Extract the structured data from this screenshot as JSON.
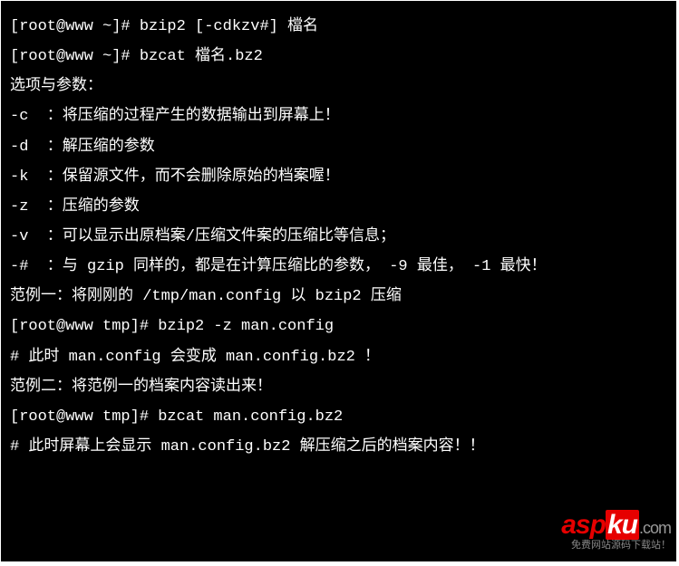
{
  "lines": {
    "l1": "[root@www ~]# bzip2 [-cdkzv#] 檔名",
    "l2": "[root@www ~]# bzcat 檔名.bz2",
    "l3": "选项与参数：",
    "l4": "-c  ：将压缩的过程产生的数据输出到屏幕上！",
    "l5": "-d  ：解压缩的参数",
    "l6": "-k  ：保留源文件，而不会删除原始的档案喔！",
    "l7": "-z  ：压缩的参数",
    "l8": "-v  ：可以显示出原档案/压缩文件案的压缩比等信息；",
    "l9": "-#  ：与 gzip 同样的，都是在计算压缩比的参数， -9 最佳， -1 最快！",
    "l10": "",
    "l11": "范例一：将刚刚的 /tmp/man.config 以 bzip2 压缩",
    "l12": "[root@www tmp]# bzip2 -z man.config",
    "l13": "# 此时 man.config 会变成 man.config.bz2 ！",
    "l14": "",
    "l15": "范例二：将范例一的档案内容读出来！",
    "l16": "[root@www tmp]# bzcat man.config.bz2",
    "l17": "# 此时屏幕上会显示 man.config.bz2 解压缩之后的档案内容！！"
  },
  "watermark": {
    "asp": "asp",
    "ku": "ku",
    "dot": ".",
    "com": "com",
    "sub": "免费网站源码下载站！"
  }
}
